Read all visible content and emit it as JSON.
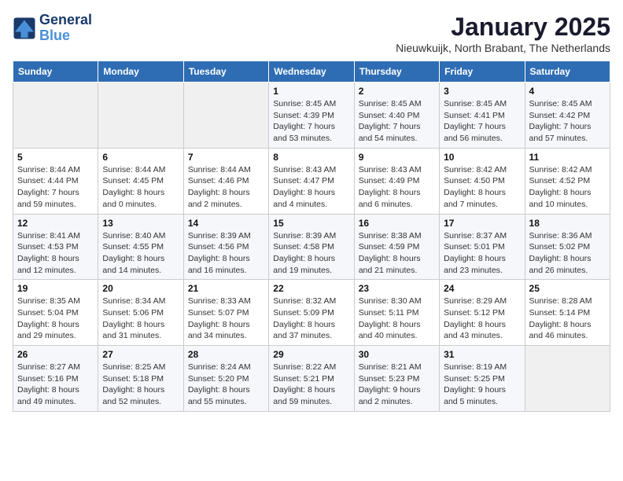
{
  "logo": {
    "line1": "General",
    "line2": "Blue"
  },
  "title": "January 2025",
  "location": "Nieuwkuijk, North Brabant, The Netherlands",
  "weekdays": [
    "Sunday",
    "Monday",
    "Tuesday",
    "Wednesday",
    "Thursday",
    "Friday",
    "Saturday"
  ],
  "weeks": [
    [
      {
        "day": "",
        "info": ""
      },
      {
        "day": "",
        "info": ""
      },
      {
        "day": "",
        "info": ""
      },
      {
        "day": "1",
        "info": "Sunrise: 8:45 AM\nSunset: 4:39 PM\nDaylight: 7 hours\nand 53 minutes."
      },
      {
        "day": "2",
        "info": "Sunrise: 8:45 AM\nSunset: 4:40 PM\nDaylight: 7 hours\nand 54 minutes."
      },
      {
        "day": "3",
        "info": "Sunrise: 8:45 AM\nSunset: 4:41 PM\nDaylight: 7 hours\nand 56 minutes."
      },
      {
        "day": "4",
        "info": "Sunrise: 8:45 AM\nSunset: 4:42 PM\nDaylight: 7 hours\nand 57 minutes."
      }
    ],
    [
      {
        "day": "5",
        "info": "Sunrise: 8:44 AM\nSunset: 4:44 PM\nDaylight: 7 hours\nand 59 minutes."
      },
      {
        "day": "6",
        "info": "Sunrise: 8:44 AM\nSunset: 4:45 PM\nDaylight: 8 hours\nand 0 minutes."
      },
      {
        "day": "7",
        "info": "Sunrise: 8:44 AM\nSunset: 4:46 PM\nDaylight: 8 hours\nand 2 minutes."
      },
      {
        "day": "8",
        "info": "Sunrise: 8:43 AM\nSunset: 4:47 PM\nDaylight: 8 hours\nand 4 minutes."
      },
      {
        "day": "9",
        "info": "Sunrise: 8:43 AM\nSunset: 4:49 PM\nDaylight: 8 hours\nand 6 minutes."
      },
      {
        "day": "10",
        "info": "Sunrise: 8:42 AM\nSunset: 4:50 PM\nDaylight: 8 hours\nand 7 minutes."
      },
      {
        "day": "11",
        "info": "Sunrise: 8:42 AM\nSunset: 4:52 PM\nDaylight: 8 hours\nand 10 minutes."
      }
    ],
    [
      {
        "day": "12",
        "info": "Sunrise: 8:41 AM\nSunset: 4:53 PM\nDaylight: 8 hours\nand 12 minutes."
      },
      {
        "day": "13",
        "info": "Sunrise: 8:40 AM\nSunset: 4:55 PM\nDaylight: 8 hours\nand 14 minutes."
      },
      {
        "day": "14",
        "info": "Sunrise: 8:39 AM\nSunset: 4:56 PM\nDaylight: 8 hours\nand 16 minutes."
      },
      {
        "day": "15",
        "info": "Sunrise: 8:39 AM\nSunset: 4:58 PM\nDaylight: 8 hours\nand 19 minutes."
      },
      {
        "day": "16",
        "info": "Sunrise: 8:38 AM\nSunset: 4:59 PM\nDaylight: 8 hours\nand 21 minutes."
      },
      {
        "day": "17",
        "info": "Sunrise: 8:37 AM\nSunset: 5:01 PM\nDaylight: 8 hours\nand 23 minutes."
      },
      {
        "day": "18",
        "info": "Sunrise: 8:36 AM\nSunset: 5:02 PM\nDaylight: 8 hours\nand 26 minutes."
      }
    ],
    [
      {
        "day": "19",
        "info": "Sunrise: 8:35 AM\nSunset: 5:04 PM\nDaylight: 8 hours\nand 29 minutes."
      },
      {
        "day": "20",
        "info": "Sunrise: 8:34 AM\nSunset: 5:06 PM\nDaylight: 8 hours\nand 31 minutes."
      },
      {
        "day": "21",
        "info": "Sunrise: 8:33 AM\nSunset: 5:07 PM\nDaylight: 8 hours\nand 34 minutes."
      },
      {
        "day": "22",
        "info": "Sunrise: 8:32 AM\nSunset: 5:09 PM\nDaylight: 8 hours\nand 37 minutes."
      },
      {
        "day": "23",
        "info": "Sunrise: 8:30 AM\nSunset: 5:11 PM\nDaylight: 8 hours\nand 40 minutes."
      },
      {
        "day": "24",
        "info": "Sunrise: 8:29 AM\nSunset: 5:12 PM\nDaylight: 8 hours\nand 43 minutes."
      },
      {
        "day": "25",
        "info": "Sunrise: 8:28 AM\nSunset: 5:14 PM\nDaylight: 8 hours\nand 46 minutes."
      }
    ],
    [
      {
        "day": "26",
        "info": "Sunrise: 8:27 AM\nSunset: 5:16 PM\nDaylight: 8 hours\nand 49 minutes."
      },
      {
        "day": "27",
        "info": "Sunrise: 8:25 AM\nSunset: 5:18 PM\nDaylight: 8 hours\nand 52 minutes."
      },
      {
        "day": "28",
        "info": "Sunrise: 8:24 AM\nSunset: 5:20 PM\nDaylight: 8 hours\nand 55 minutes."
      },
      {
        "day": "29",
        "info": "Sunrise: 8:22 AM\nSunset: 5:21 PM\nDaylight: 8 hours\nand 59 minutes."
      },
      {
        "day": "30",
        "info": "Sunrise: 8:21 AM\nSunset: 5:23 PM\nDaylight: 9 hours\nand 2 minutes."
      },
      {
        "day": "31",
        "info": "Sunrise: 8:19 AM\nSunset: 5:25 PM\nDaylight: 9 hours\nand 5 minutes."
      },
      {
        "day": "",
        "info": ""
      }
    ]
  ]
}
